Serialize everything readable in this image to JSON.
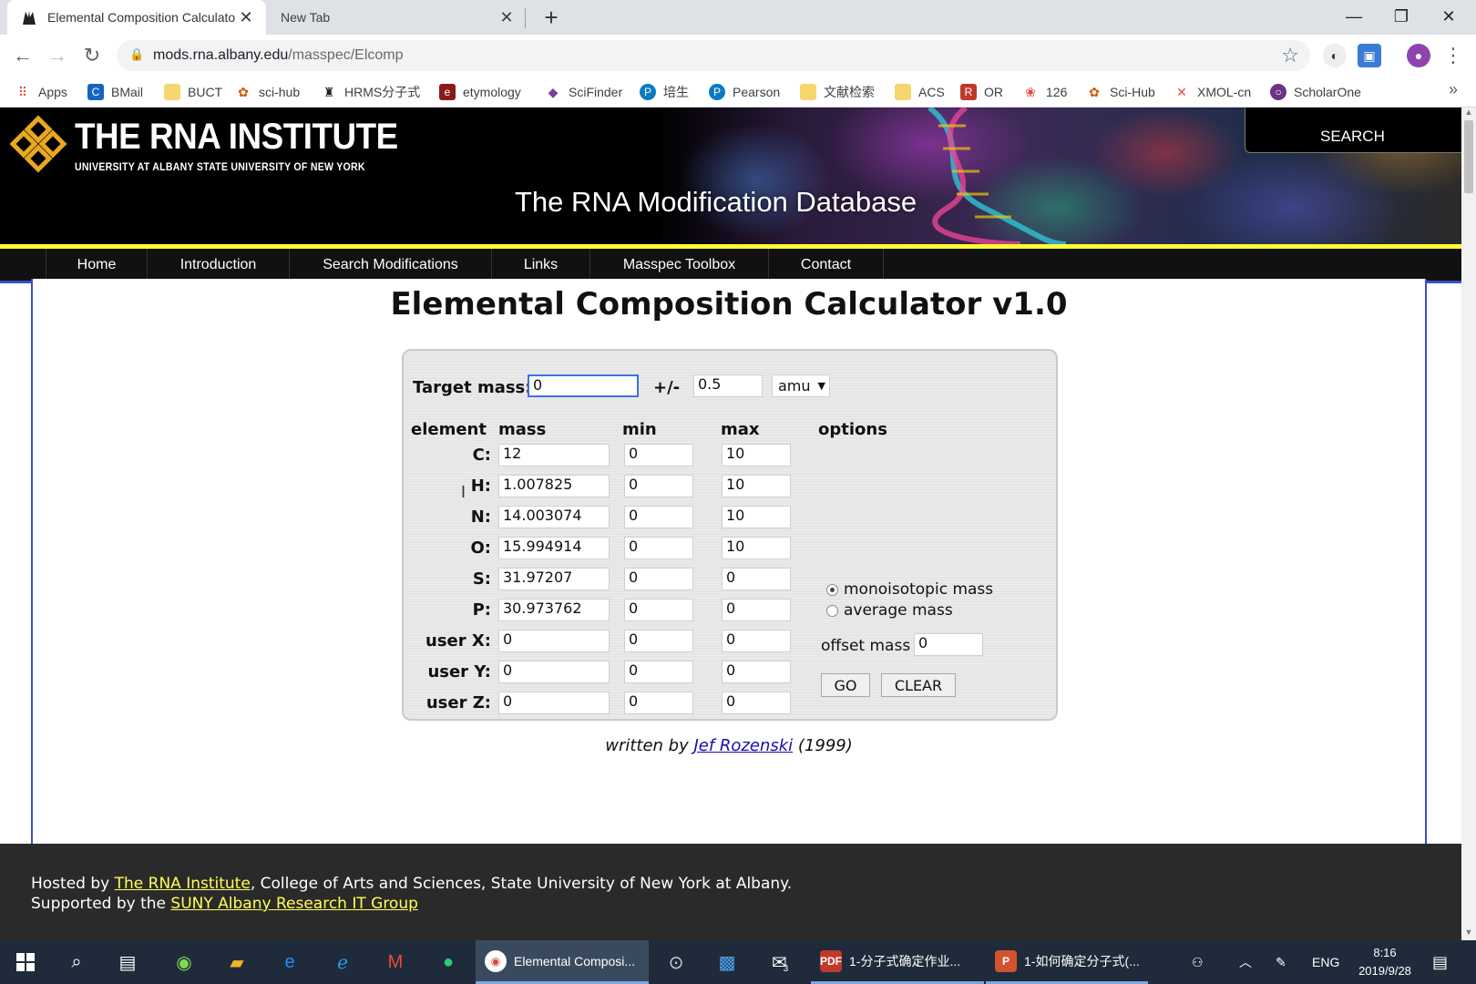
{
  "browser": {
    "tabs": [
      {
        "title": "Elemental Composition Calculato",
        "active": true
      },
      {
        "title": "New Tab",
        "active": false
      }
    ],
    "url_host": "mods.rna.albany.edu",
    "url_path": "/masspec/Elcomp",
    "bookmarks": [
      "Apps",
      "BMail",
      "BUCT",
      "sci-hub",
      "HRMS分子式",
      "etymology",
      "SciFinder",
      "培生",
      "Pearson",
      "文献检索",
      "ACS",
      "OR",
      "126",
      "Sci-Hub",
      "XMOL-cn",
      "ScholarOne"
    ],
    "bookmark_more": "»"
  },
  "site": {
    "logo_title": "THE RNA INSTITUTE",
    "logo_subtitle": "UNIVERSITY AT ALBANY STATE UNIVERSITY OF NEW YORK",
    "header_title": "The RNA Modification Database",
    "search_label": "SEARCH",
    "nav": [
      "Home",
      "Introduction",
      "Search Modifications",
      "Links",
      "Masspec Toolbox",
      "Contact"
    ]
  },
  "calculator": {
    "page_title": "Elemental Composition Calculator v1.0",
    "target_label": "Target mass:",
    "target_value": "0",
    "tolerance_label": "+/-",
    "tolerance_value": "0.5",
    "unit_selected": "amu",
    "headers": {
      "element": "element",
      "mass": "mass",
      "min": "min",
      "max": "max",
      "options": "options"
    },
    "rows": [
      {
        "label": "C:",
        "mass": "12",
        "min": "0",
        "max": "10"
      },
      {
        "label": "H:",
        "mass": "1.007825",
        "min": "0",
        "max": "10"
      },
      {
        "label": "N:",
        "mass": "14.003074",
        "min": "0",
        "max": "10"
      },
      {
        "label": "O:",
        "mass": "15.994914",
        "min": "0",
        "max": "10"
      },
      {
        "label": "S:",
        "mass": "31.97207",
        "min": "0",
        "max": "0"
      },
      {
        "label": "P:",
        "mass": "30.973762",
        "min": "0",
        "max": "0"
      },
      {
        "label": "user X:",
        "mass": "0",
        "min": "0",
        "max": "0"
      },
      {
        "label": "user Y:",
        "mass": "0",
        "min": "0",
        "max": "0"
      },
      {
        "label": "user Z:",
        "mass": "0",
        "min": "0",
        "max": "0"
      }
    ],
    "mass_options": {
      "monoisotopic": "monoisotopic mass",
      "average": "average mass",
      "selected": "monoisotopic"
    },
    "offset_label": "offset mass",
    "offset_value": "0",
    "go_label": "GO",
    "clear_label": "CLEAR",
    "credit_prefix": "written by",
    "credit_author": "Jef Rozenski",
    "credit_year": "(1999)"
  },
  "footer": {
    "line1_prefix": "Hosted by",
    "line1_link": "The RNA Institute",
    "line1_suffix": ", College of Arts and Sciences, State University of New York at Albany.",
    "line2_prefix": "Supported by the",
    "line2_link": "SUNY Albany Research IT Group"
  },
  "taskbar": {
    "tasks": [
      "Elemental Composi...",
      "1-分子式确定作业...",
      "1-如何确定分子式(..."
    ],
    "mail_badge": "3",
    "language": "ENG",
    "time": "8:16",
    "date": "2019/9/28"
  }
}
